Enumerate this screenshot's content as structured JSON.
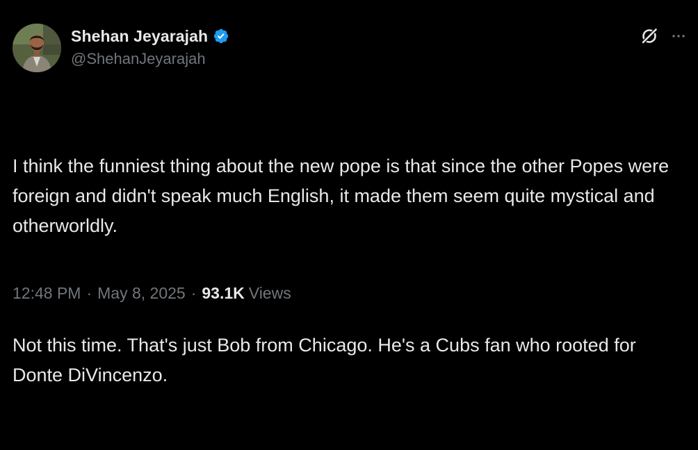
{
  "author": {
    "display_name": "Shehan Jeyarajah",
    "handle": "@ShehanJeyarajah",
    "verified": true,
    "verified_color": "#1d9bf0"
  },
  "tweet": {
    "paragraphs": [
      "I think the funniest thing about the new pope is that since the other Popes were foreign and didn't speak much English, it made them seem quite mystical and otherworldly.",
      "Not this time. That's just Bob from Chicago. He's a Cubs fan who rooted for Donte DiVincenzo."
    ]
  },
  "meta": {
    "time": "12:48 PM",
    "separator": "·",
    "date": "May 8, 2025",
    "views_count": "93.1K",
    "views_label": "Views"
  },
  "icons": {
    "avatar": "avatar",
    "verified": "verified-badge-icon",
    "grok": "grok-icon",
    "more": "more-options-icon"
  },
  "colors": {
    "background": "#000000",
    "primary_text": "#e7e9ea",
    "secondary_text": "#71767b",
    "accent": "#1d9bf0"
  }
}
